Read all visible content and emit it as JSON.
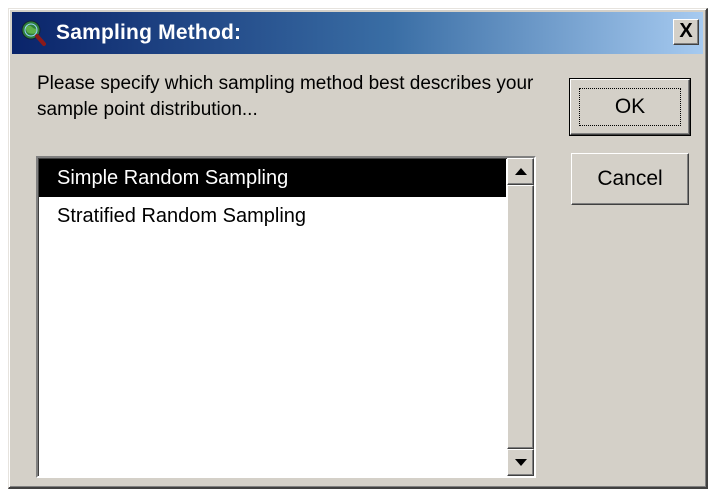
{
  "window": {
    "title": "Sampling Method:",
    "close_label": "X",
    "icon": "globe-magnifier-icon"
  },
  "prompt": {
    "text": "Please specify which sampling method best describes your sample point distribution..."
  },
  "buttons": {
    "ok_label": "OK",
    "cancel_label": "Cancel"
  },
  "list": {
    "items": [
      {
        "label": "Simple Random Sampling",
        "selected": true
      },
      {
        "label": "Stratified Random Sampling",
        "selected": false
      }
    ]
  },
  "colors": {
    "titlebar_start": "#0a246a",
    "titlebar_end": "#a6caf0",
    "dialog_face": "#d4d0c8",
    "selection": "#000000"
  }
}
